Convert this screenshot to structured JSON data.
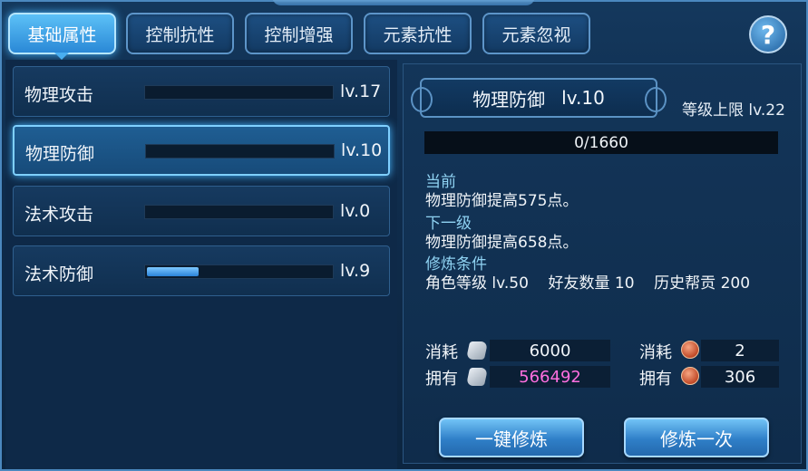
{
  "tabs": [
    {
      "label": "基础属性",
      "active": true
    },
    {
      "label": "控制抗性",
      "active": false
    },
    {
      "label": "控制增强",
      "active": false
    },
    {
      "label": "元素抗性",
      "active": false
    },
    {
      "label": "元素忽视",
      "active": false
    }
  ],
  "help_label": "?",
  "attributes": [
    {
      "name": "物理攻击",
      "level": "lv.17",
      "progress": 0
    },
    {
      "name": "物理防御",
      "level": "lv.10",
      "progress": 0,
      "selected": true
    },
    {
      "name": "法术攻击",
      "level": "lv.0",
      "progress": 0
    },
    {
      "name": "法术防御",
      "level": "lv.9",
      "progress": 0.28
    }
  ],
  "detail": {
    "title_name": "物理防御",
    "title_level": "lv.10",
    "max_level": "等级上限 lv.22",
    "exp_text": "0/1660",
    "current_label": "当前",
    "current_desc": "物理防御提高575点。",
    "next_label": "下一级",
    "next_desc": "物理防御提高658点。",
    "condition_label": "修炼条件",
    "condition_desc": "角色等级 lv.50    好友数量 10    历史帮贡 200"
  },
  "costs": {
    "consume_label": "消耗",
    "own_label": "拥有",
    "scroll_consume": "6000",
    "scroll_own": "566492",
    "coin_consume": "2",
    "coin_own": "306",
    "scroll_icon": "scroll-icon",
    "coin_icon": "copper-coin-icon",
    "own_highlight_color": "#ff6fe0"
  },
  "buttons": {
    "one_key": "一键修炼",
    "once": "修炼一次"
  }
}
